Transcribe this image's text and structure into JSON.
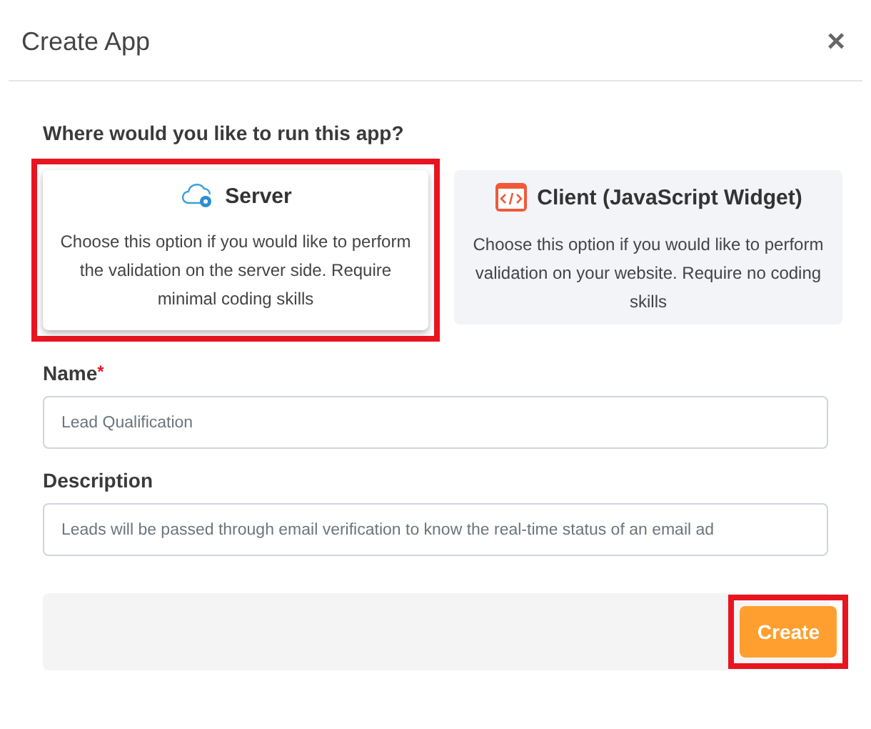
{
  "dialog": {
    "title": "Create App",
    "close": "×"
  },
  "question": "Where would you like to run this app?",
  "options": [
    {
      "kind": "server",
      "title": "Server",
      "description": "Choose this option if you would like to perform the validation on the server side. Require minimal coding skills",
      "selected": true
    },
    {
      "kind": "client",
      "title": "Client (JavaScript Widget)",
      "description": "Choose this option if you would like to perform validation on your website. Require no coding skills",
      "selected": false
    }
  ],
  "fields": [
    {
      "label": "Name",
      "required_mark": "*",
      "value": "Lead Qualification"
    },
    {
      "label": "Description",
      "value": "Leads will be passed through email verification to know the real-time status of an email ad"
    }
  ],
  "footer": {
    "button": "Create",
    "highlighted": true
  }
}
